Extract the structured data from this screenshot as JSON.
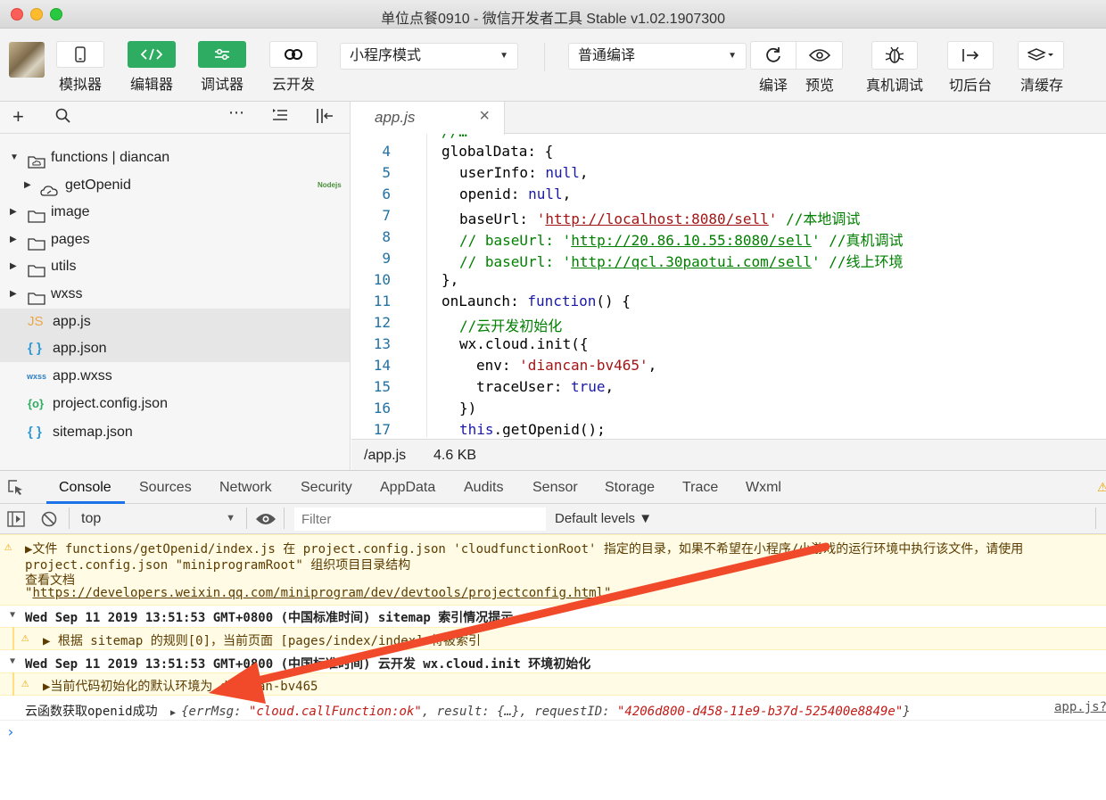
{
  "window": {
    "title": "单位点餐0910 - 微信开发者工具 Stable v1.02.1907300"
  },
  "toolbar": {
    "simulator": "模拟器",
    "editor": "编辑器",
    "debugger": "调试器",
    "cloud": "云开发",
    "mode_select": "小程序模式",
    "compile_select": "普通编译",
    "compile": "编译",
    "preview": "预览",
    "real_debug": "真机调试",
    "background": "切后台",
    "clear_cache": "清缓存"
  },
  "sidebar": {
    "tree": [
      {
        "label": "functions | diancan"
      },
      {
        "label": "getOpenid",
        "badge": "Nodejs"
      },
      {
        "label": "image"
      },
      {
        "label": "pages"
      },
      {
        "label": "utils"
      },
      {
        "label": "wxss"
      },
      {
        "label": "app.js",
        "icon": "JS"
      },
      {
        "label": "app.json",
        "icon": "{ }"
      },
      {
        "label": "app.wxss",
        "icon": "wxss"
      },
      {
        "label": "project.config.json",
        "icon": "{o}"
      },
      {
        "label": "sitemap.json",
        "icon": "{ }"
      }
    ]
  },
  "editor": {
    "tab": "app.js",
    "line_numbers": [
      "4",
      "5",
      "6",
      "7",
      "8",
      "9",
      "10",
      "11",
      "12",
      "13",
      "14",
      "15",
      "16",
      "17"
    ],
    "code": {
      "l4": "globalData: {",
      "l5a": "userInfo: ",
      "l5b": "null",
      "l5c": ",",
      "l6a": "openid: ",
      "l6b": "null",
      "l6c": ",",
      "l7a": "baseUrl: ",
      "l7b": "'",
      "l7c": "http://localhost:8080/sell",
      "l7d": "'",
      "l7e": " //本地调试",
      "l8a": "// baseUrl: '",
      "l8b": "http://20.86.10.55:8080/sell",
      "l8c": "' //真机调试",
      "l9a": "// baseUrl: '",
      "l9b": "http://qcl.30paotui.com/sell",
      "l9c": "' //线上环境",
      "l10": "},",
      "l11a": "onLaunch: ",
      "l11b": "function",
      "l11c": "() {",
      "l12": "//云开发初始化",
      "l13": "wx.cloud.init({",
      "l14a": "env: ",
      "l14b": "'diancan-bv465'",
      "l14c": ",",
      "l15a": "traceUser: ",
      "l15b": "true",
      "l15c": ",",
      "l16": "})",
      "l17a": "this",
      "l17b": ".getOpenid();"
    },
    "status_path": "/app.js",
    "status_size": "4.6 KB"
  },
  "devtools": {
    "tabs": [
      "Console",
      "Sources",
      "Network",
      "Security",
      "AppData",
      "Audits",
      "Sensor",
      "Storage",
      "Trace",
      "Wxml"
    ],
    "context": "top",
    "filter_placeholder": "Filter",
    "levels": "Default levels ▼",
    "messages": {
      "w1_line1": "▶文件 functions/getOpenid/index.js 在 project.config.json 'cloudfunctionRoot' 指定的目录，如果不希望在小程序/小游戏的运行环境中执行该文件，请使用",
      "w1_line2": "project.config.json \"miniprogramRoot\" 组织项目目录结构",
      "w1_line3": "查看文档",
      "w1_line4a": "\"",
      "w1_line4b": "https://developers.weixin.qq.com/miniprogram/dev/devtools/projectconfig.html",
      "w1_line4c": "\"",
      "g1_title": "Wed Sep 11 2019 13:51:53 GMT+0800 (中国标准时间) sitemap 索引情况提示",
      "g1_msg": "▶ 根据 sitemap 的规则[0]，当前页面 [pages/index/index] 将被索引",
      "g2_title": "Wed Sep 11 2019 13:51:53 GMT+0800 (中国标准时间) 云开发 wx.cloud.init 环境初始化",
      "g2_msg": "▶当前代码初始化的默认环境为 diancan-bv465",
      "log_prefix": "云函数获取openid成功 ",
      "log_k1": "errMsg: ",
      "log_v1": "\"cloud.callFunction:ok\"",
      "log_k2": ", result: ",
      "log_v2": "{…}",
      "log_k3": ", requestID: ",
      "log_v3": "\"4206d800-d458-11e9-b37d-525400e8849e\"",
      "log_src": "app.js?"
    },
    "prompt": "›"
  },
  "colors": {
    "accent_green": "#2ead62",
    "arrow": "#f04a2b",
    "warn_bg": "#fffbe5"
  }
}
